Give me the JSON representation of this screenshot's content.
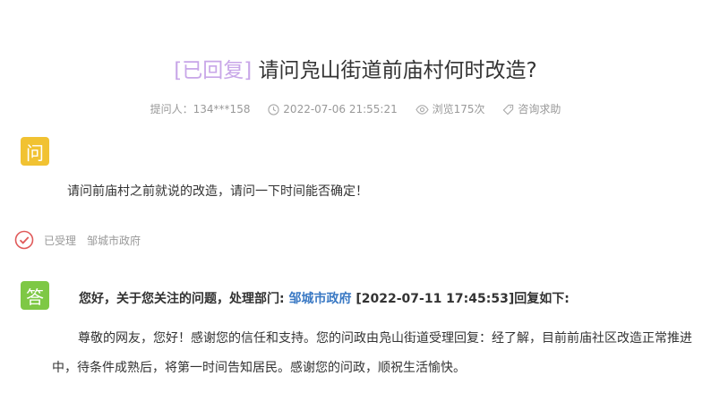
{
  "title": {
    "status": "[已回复]",
    "text": " 请问凫山街道前庙村何时改造?"
  },
  "meta": {
    "asker": "提问人：134***158",
    "time": "2022-07-06 21:55:21",
    "views": "浏览175次",
    "category": "咨询求助"
  },
  "question": {
    "badge": "问",
    "text": "请问前庙村之前就说的改造，请问一下时间能否确定！"
  },
  "acceptance": {
    "status": "已受理",
    "department": "邹城市政府"
  },
  "answer": {
    "badge": "答",
    "intro": "您好，关于您关注的问题，处理部门: ",
    "department": "邹城市政府",
    "date_suffix": " [2022-07-11 17:45:53]回复如下:",
    "body": "尊敬的网友，您好！感谢您的信任和支持。您的问政由凫山街道受理回复：经了解，目前前庙社区改造正常推进中，待条件成熟后，将第一时间告知居民。感谢您的问政，顺祝生活愉快。"
  },
  "colors": {
    "status_purple": "#c8a6e8",
    "question_badge": "#f1c232",
    "answer_badge": "#7ec845",
    "link_blue": "#3a79c4",
    "check_red": "#e05a5a"
  }
}
